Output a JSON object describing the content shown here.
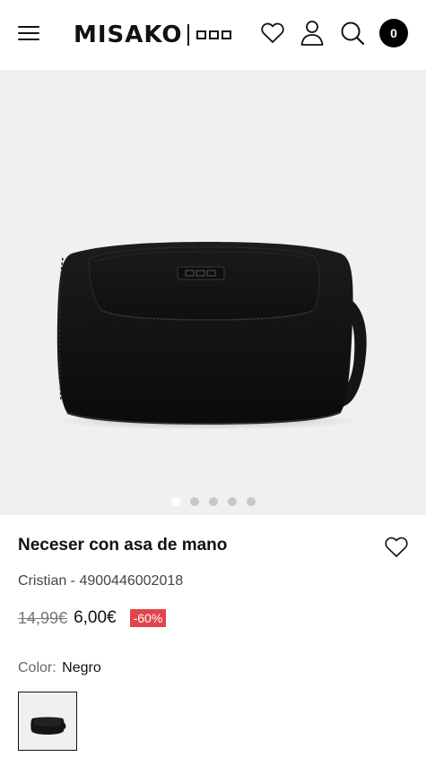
{
  "header": {
    "brand": "MISAKO",
    "cart_count": "0",
    "icons": [
      "menu-icon",
      "heart-icon",
      "user-icon",
      "search-icon"
    ]
  },
  "gallery": {
    "image": "black-toiletry-bag",
    "slide_count": 5,
    "active_slide": 1
  },
  "product": {
    "title": "Neceser con asa de mano",
    "sku": "Cristian - 4900446002018",
    "old_price": "14,99€",
    "price": "6,00€",
    "discount": "-60%",
    "color_label": "Color:",
    "color_value": "Negro"
  },
  "colors": {
    "discount_badge": "#e2444b",
    "gallery_bg": "#f0f0f0",
    "text": "#111111"
  }
}
